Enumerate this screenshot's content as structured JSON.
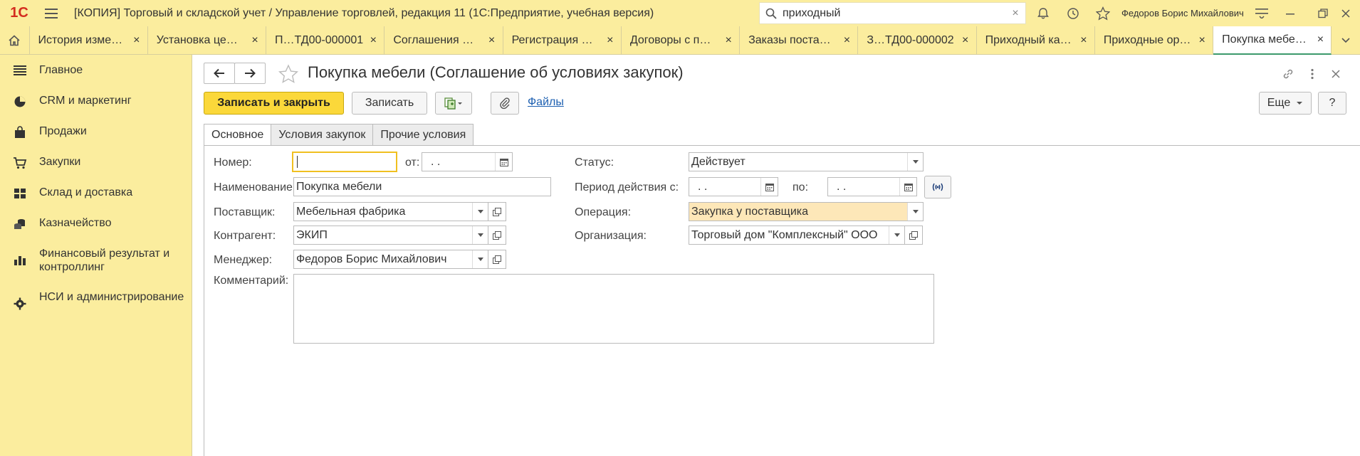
{
  "app": {
    "logo": "1С",
    "title": "[КОПИЯ] Торговый и складской учет / Управление торговлей, редакция 11  (1С:Предприятие, учебная версия)",
    "search_value": "приходный",
    "search_clear": "×",
    "user": "Федоров Борис Михайлович"
  },
  "tabs": [
    {
      "label": "История изме…",
      "close": "×"
    },
    {
      "label": "Установка це…",
      "close": "×"
    },
    {
      "label": "П…ТД00-000001",
      "close": "×"
    },
    {
      "label": "Соглашения …",
      "close": "×"
    },
    {
      "label": "Регистрация …",
      "close": "×"
    },
    {
      "label": "Договоры с п…",
      "close": "×"
    },
    {
      "label": "Заказы поста…",
      "close": "×"
    },
    {
      "label": "З…ТД00-000002",
      "close": "×"
    },
    {
      "label": "Приходный ка…",
      "close": "×"
    },
    {
      "label": "Приходные ор…",
      "close": "×"
    },
    {
      "label": "Покупка мебе…",
      "close": "×"
    }
  ],
  "sidebar": {
    "items": [
      {
        "label": "Главное",
        "icon": "menu-lines-icon"
      },
      {
        "label": "CRM и маркетинг",
        "icon": "pie-chart-icon"
      },
      {
        "label": "Продажи",
        "icon": "shopping-bag-icon"
      },
      {
        "label": "Закупки",
        "icon": "cart-icon"
      },
      {
        "label": "Склад и доставка",
        "icon": "warehouse-grid-icon"
      },
      {
        "label": "Казначейство",
        "icon": "coins-icon"
      },
      {
        "label": "Финансовый результат и контроллинг",
        "icon": "bar-chart-icon"
      },
      {
        "label": "НСИ и администрирование",
        "icon": "gear-icon"
      }
    ]
  },
  "form": {
    "title": "Покупка мебели (Соглашение об условиях закупок)",
    "btn_save_close": "Записать и закрыть",
    "btn_save": "Записать",
    "link_files": "Файлы",
    "btn_more": "Еще",
    "btn_help": "?",
    "tabs": [
      "Основное",
      "Условия закупок",
      "Прочие условия"
    ],
    "fields": {
      "number_label": "Номер:",
      "number_value": "",
      "date_label": "от:",
      "date_value": " .  .",
      "status_label": "Статус:",
      "status_value": "Действует",
      "name_label": "Наименование:",
      "name_value": "Покупка мебели",
      "period_label": "Период действия с:",
      "period_from": " .  .",
      "period_to_label": "по:",
      "period_to": " .  .",
      "supplier_label": "Поставщик:",
      "supplier_value": "Мебельная фабрика",
      "operation_label": "Операция:",
      "operation_value": "Закупка у поставщика",
      "counterparty_label": "Контрагент:",
      "counterparty_value": "ЭКИП",
      "organization_label": "Организация:",
      "organization_value": "Торговый дом \"Комплексный\" ООО",
      "manager_label": "Менеджер:",
      "manager_value": "Федоров Борис Михайлович",
      "comment_label": "Комментарий:",
      "comment_value": ""
    }
  },
  "colors": {
    "panel_bg": "#fbed9e",
    "primary_button": "#fbd83a",
    "link": "#1e60b1",
    "operation_highlight": "#fde7b8"
  }
}
